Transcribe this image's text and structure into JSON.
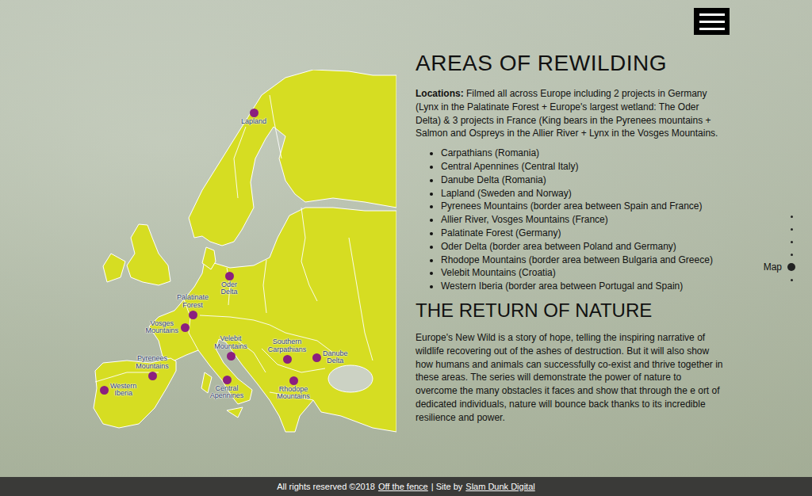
{
  "page": {
    "title": "AREAS OF REWILDING"
  },
  "locations": {
    "label": "Locations:",
    "text": "Filmed all across Europe including 2 projects in Germany (Lynx in the Palatinate Forest + Europe's largest wetland: The Oder Delta) & 3 projects in France (King bears in the Pyrenees mountains + Salmon and Ospreys in the Allier River + Lynx in the Vosges Mountains."
  },
  "areas": [
    "Carpathians (Romania)",
    "Central Apennines (Central Italy)",
    "Danube Delta (Romania)",
    "Lapland (Sweden and Norway)",
    "Pyrenees Mountains (border area between Spain and France)",
    "Allier River, Vosges Mountains (France)",
    "Palatinate Forest (Germany)",
    "Oder Delta (border area between Poland and Germany)",
    "Rhodope Mountains (border area between Bulgaria and Greece)",
    "Velebit Mountains (Croatia)",
    "Western Iberia (border area between Portugal and Spain)"
  ],
  "section": {
    "title": "THE RETURN OF NATURE",
    "text": "Europe's New Wild is a story of hope, telling the inspiring narrative of wildlife recovering out of the ashes of destruction. But it will also show how humans and animals can successfully co-exist and thrive together in these areas. The series will demonstrate the power of nature to overcome the many obstacles it faces and show that through the e ort of dedicated individuals, nature will bounce back thanks to its incredible resilience and power."
  },
  "map": {
    "pins": [
      {
        "label": "Lapland"
      },
      {
        "label": "Oder Delta"
      },
      {
        "label": "Palatinate Forest"
      },
      {
        "label": "Vosges Mountains"
      },
      {
        "label": "Velebit Mountains"
      },
      {
        "label": "Southern Carpathians"
      },
      {
        "label": "Danube Delta"
      },
      {
        "label": "Pyrenees Mountains"
      },
      {
        "label": "Western Iberia"
      },
      {
        "label": "Central Apennines"
      },
      {
        "label": "Rhodope Mountains"
      }
    ]
  },
  "side_nav": [
    {
      "label": "",
      "selected": false
    },
    {
      "label": "",
      "selected": false
    },
    {
      "label": "",
      "selected": false
    },
    {
      "label": "",
      "selected": false
    },
    {
      "label": "Map",
      "selected": true
    },
    {
      "label": "",
      "selected": false
    }
  ],
  "footer": [
    {
      "text": "All rights reserved ©2018",
      "kind": "text"
    },
    {
      "text": "Off the fence",
      "kind": "link"
    },
    {
      "text": "| Site by",
      "kind": "text"
    },
    {
      "text": "Slam Dunk Digital",
      "kind": "link"
    }
  ]
}
